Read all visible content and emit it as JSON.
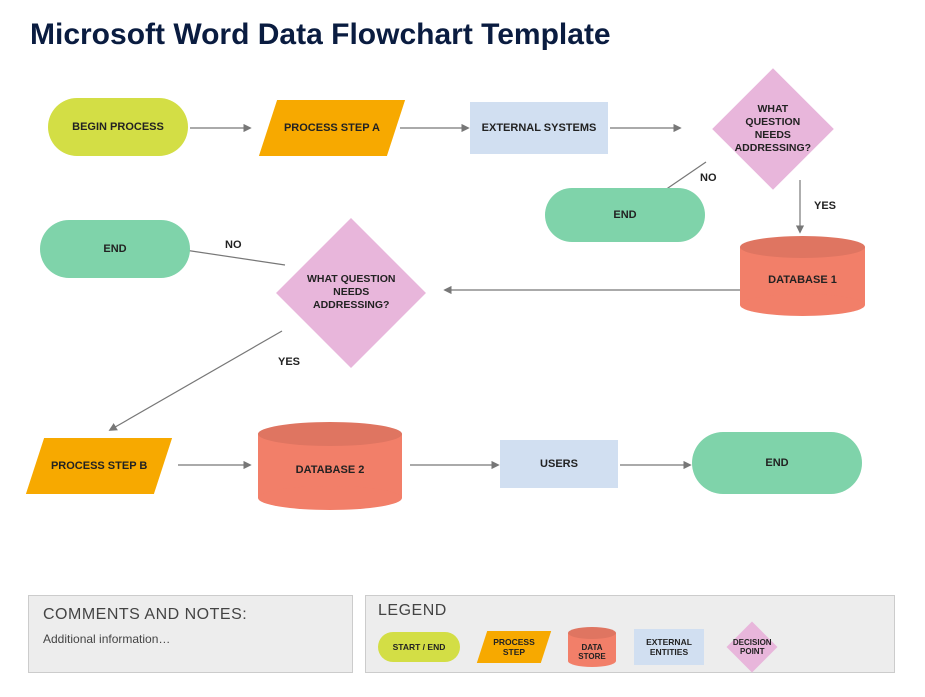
{
  "title": "Microsoft Word Data Flowchart Template",
  "nodes": {
    "begin": "BEGIN PROCESS",
    "stepA": "PROCESS STEP A",
    "external": "EXTERNAL SYSTEMS",
    "decision1": "WHAT QUESTION NEEDS ADDRESSING?",
    "end_top": "END",
    "db1": "DATABASE 1",
    "decision2": "WHAT QUESTION NEEDS ADDRESSING?",
    "end_left": "END",
    "stepB": "PROCESS STEP B",
    "db2": "DATABASE 2",
    "users": "USERS",
    "end_right": "END"
  },
  "edge_labels": {
    "no1": "NO",
    "yes1": "YES",
    "no2": "NO",
    "yes2": "YES"
  },
  "footer": {
    "comments_title": "COMMENTS AND NOTES:",
    "comments_text": "Additional information…",
    "legend_title": "LEGEND",
    "legend": {
      "start_end": "START / END",
      "process": "PROCESS STEP",
      "datastore": "DATA STORE",
      "external": "EXTERNAL ENTITIES",
      "decision": "DECISION POINT"
    }
  }
}
